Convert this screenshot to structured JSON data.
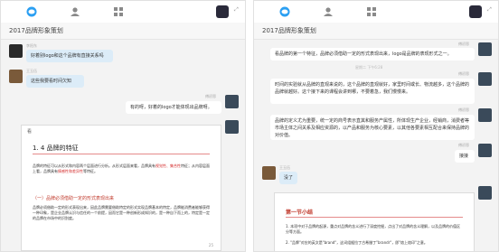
{
  "colors": {
    "accent": "#2b9ff2",
    "bubble_out": "#dcecf8",
    "doc_red": "#d42b2b"
  },
  "left": {
    "icons": [
      "chat-icon",
      "contacts-icon",
      "grid-icon"
    ],
    "title": "2017品牌形象策划",
    "messages": [
      {
        "sender": "李阳东",
        "text": "好着别logo和这个品牌有直接关系吗"
      },
      {
        "sender": "王玉伍",
        "text": "这些我要看时间欠知"
      },
      {
        "sender": "傅初恩",
        "text": "有的呀，好着的logo才能体现出品牌呀。"
      }
    ],
    "doc": {
      "file": "看",
      "heading": "1. 4  品牌的特征",
      "para1a": "品牌的特征可以从形式和内容两个层面进行分析。从形式层面来看，品牌具有",
      "para1_red": "视觉性、集合性",
      "para1b": "特征；从内容层面上看，品牌具有",
      "para1_red2": "情感性和差异性",
      "para1c": "等特征。",
      "subhead": "（一）品牌必须借助一定的形式表现出来",
      "para2": "品牌必须借助一定的形式表现出来，因此品牌需要借助特定的形式实现品牌基本的特定，品牌能消费者能够获得一种印象，是企业品牌认识与信任的一个前提，因而它是一种创新形成知识的，是一种自下而上的，特定是一定的品牌在市场中的识别度。",
      "page": "25"
    }
  },
  "right": {
    "icons": [
      "chat-icon",
      "contacts-icon",
      "grid-icon"
    ],
    "title": "2017品牌形象策划",
    "messages": [
      {
        "sender": "傅初恩",
        "text": "看品牌的第一个特征，品牌必须借助一定的形式表现出来，logo是品牌的表现形式之一。"
      },
      {
        "stamp": "星期二 下午6:28"
      },
      {
        "sender": "傅初恩",
        "text": "时间的实验就从品牌的直观来说的，这个品牌的直观就好，家里时间或长、物流越多，这个品牌的品牌就越好。这个接下来的课程会讲到哪，不要着急，我们慢慢来。"
      },
      {
        "sender": "傅初恩",
        "text": "品牌的定义尤为重要，统一定的商号表示直其和服务产属性，所体现生产企业，经销商，消费者等市场主体之间关系及相应资源的，以产品和服务为核心要素，以其他各要素相互配合来保持品牌的对价值。"
      },
      {
        "sender": "傅初恩",
        "text": "接接"
      },
      {
        "sender": "王玉伍",
        "text": "没了"
      }
    ],
    "doc": {
      "section": "第一节小结",
      "line1": "1. 本项中对于品牌的起源，重点对品牌的含义进行了深度挖掘，点出了对品牌的含义理解，以及品牌的价值区分等方面。",
      "line2": "2. \"品牌\"对应的英文是\"brand\"，这词组据拉丁古希腊丁\"brandr\"，即\"烙上烙印\"之意。"
    }
  }
}
